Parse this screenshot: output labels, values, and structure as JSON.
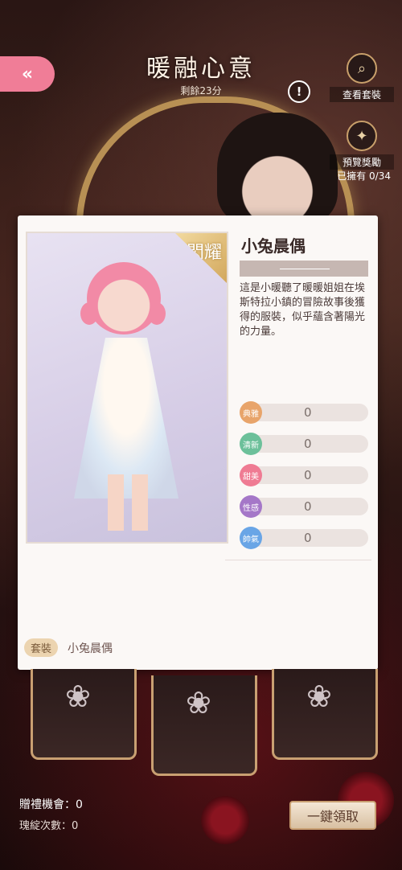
{
  "header": {
    "title": "暖融心意",
    "remaining": "剩餘23分"
  },
  "side_buttons": {
    "view_set": "查看套裝",
    "preview_reward": "預覽獎勵",
    "owned": "已擁有 0/34"
  },
  "item": {
    "badge": "閃耀",
    "name": "小兔晨偶",
    "description": "這是小暖聽了暖暖姐姐在埃斯特拉小鎮的冒險故事後獲得的服裝，似乎蘊含著陽光的力量。",
    "stats": [
      {
        "label": "典雅",
        "value": "0",
        "color": "#e8a46a"
      },
      {
        "label": "清新",
        "value": "0",
        "color": "#6cc09a"
      },
      {
        "label": "甜美",
        "value": "0",
        "color": "#ef7b93"
      },
      {
        "label": "性感",
        "value": "0",
        "color": "#a577c8"
      },
      {
        "label": "帥氣",
        "value": "0",
        "color": "#69a5e6"
      }
    ],
    "set_label": "套裝",
    "set_name": "小兔晨偶"
  },
  "footer": {
    "gift_chances": "贈禮機會：0",
    "spin_count": "瑰綻次數：0",
    "claim_all": "一鍵領取"
  }
}
